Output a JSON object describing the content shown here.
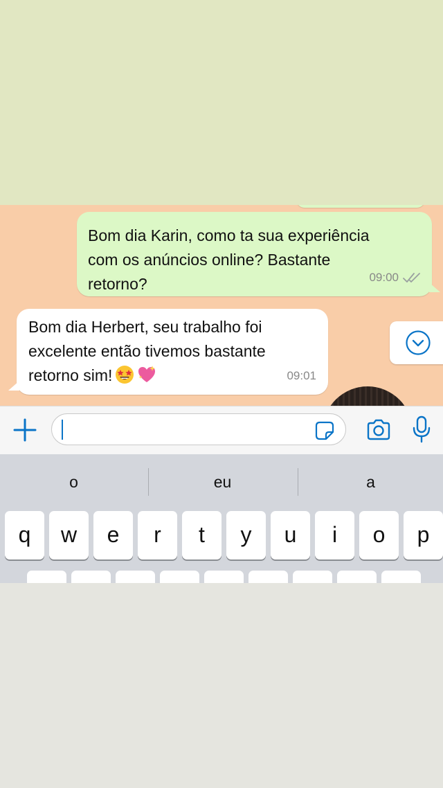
{
  "colors": {
    "top_band": "#e1e7c2",
    "chat_background": "#f9cda8",
    "outgoing_bubble": "#dcf8c6",
    "incoming_bubble": "#ffffff",
    "accent": "#0a74c7",
    "keyboard_background": "#d3d6dc"
  },
  "messages": [
    {
      "direction": "outgoing",
      "text": "Bom dia Karin, como ta sua experiência\ncom os anúncios online? Bastante\nretorno?",
      "time": "09:00",
      "status_icon": "double-check-icon"
    },
    {
      "direction": "incoming",
      "text": "Bom dia Herbert, seu trabalho foi\nexcelente então tivemos bastante\nretorno sim!",
      "emojis": [
        "star-struck-emoji",
        "sparkling-heart-emoji"
      ],
      "time": "09:01"
    }
  ],
  "input_bar": {
    "icons": [
      "plus-icon",
      "sticker-icon",
      "camera-icon",
      "microphone-icon"
    ]
  },
  "keyboard": {
    "suggestions": [
      "o",
      "eu",
      "a"
    ],
    "row1": [
      "q",
      "w",
      "e",
      "r",
      "t",
      "y",
      "u",
      "i",
      "o",
      "p"
    ]
  }
}
